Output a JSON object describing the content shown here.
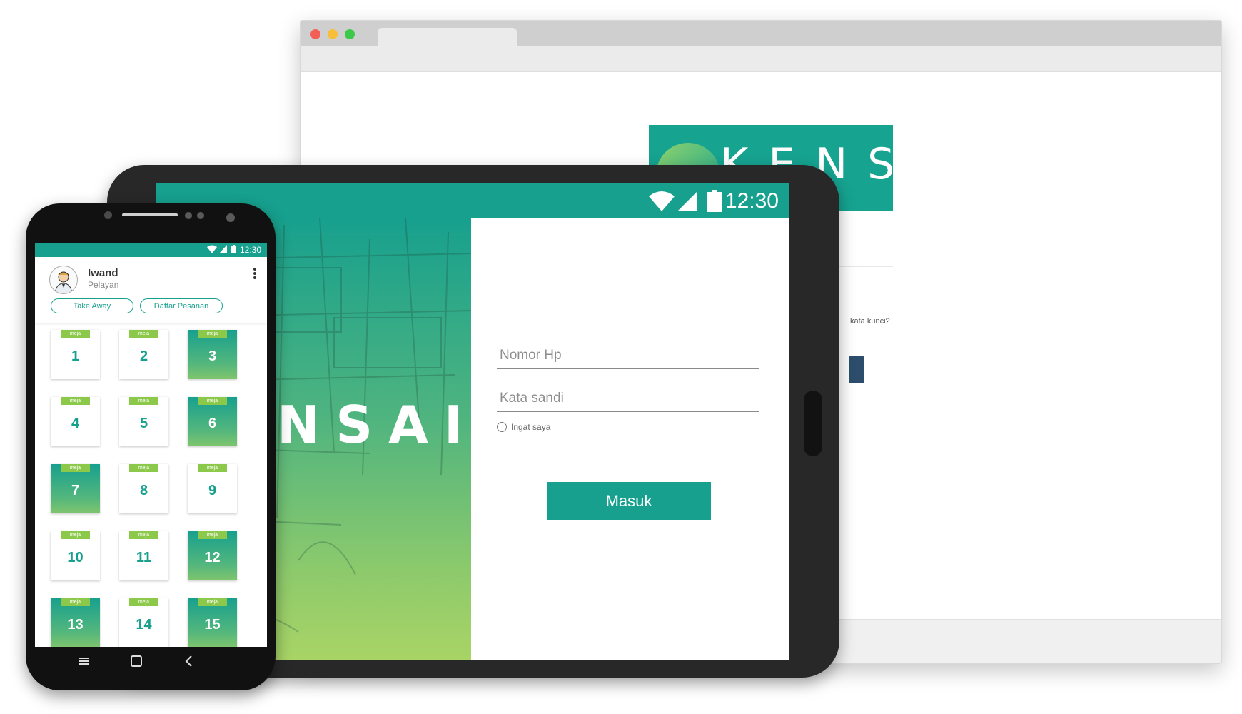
{
  "browser": {
    "logo_text": "KENSAI",
    "forgot_text": "kata kunci?"
  },
  "tablet": {
    "status_time": "12:30",
    "brand_text": "NSAI",
    "login": {
      "phone_placeholder": "Nomor Hp",
      "password_placeholder": "Kata sandi",
      "remember_label": "Ingat saya",
      "submit_label": "Masuk"
    }
  },
  "phone": {
    "status_time": "12:30",
    "user": {
      "name": "Iwand",
      "role": "Pelayan"
    },
    "buttons": {
      "take_away": "Take Away",
      "daftar_pesanan": "Daftar Pesanan"
    },
    "tables": [
      {
        "tag": "meja",
        "number": "1",
        "active": false
      },
      {
        "tag": "meja",
        "number": "2",
        "active": false
      },
      {
        "tag": "meja",
        "number": "3",
        "active": true
      },
      {
        "tag": "meja",
        "number": "4",
        "active": false
      },
      {
        "tag": "meja",
        "number": "5",
        "active": false
      },
      {
        "tag": "meja",
        "number": "6",
        "active": true
      },
      {
        "tag": "meja",
        "number": "7",
        "active": true
      },
      {
        "tag": "meja",
        "number": "8",
        "active": false
      },
      {
        "tag": "meja",
        "number": "9",
        "active": false
      },
      {
        "tag": "meja",
        "number": "10",
        "active": false
      },
      {
        "tag": "meja",
        "number": "11",
        "active": false
      },
      {
        "tag": "meja",
        "number": "12",
        "active": true
      },
      {
        "tag": "meja",
        "number": "13",
        "active": true
      },
      {
        "tag": "meja",
        "number": "14",
        "active": false
      },
      {
        "tag": "meja",
        "number": "15",
        "active": true
      }
    ]
  },
  "colors": {
    "accent": "#17a08e",
    "tag_green": "#8cc94b"
  }
}
